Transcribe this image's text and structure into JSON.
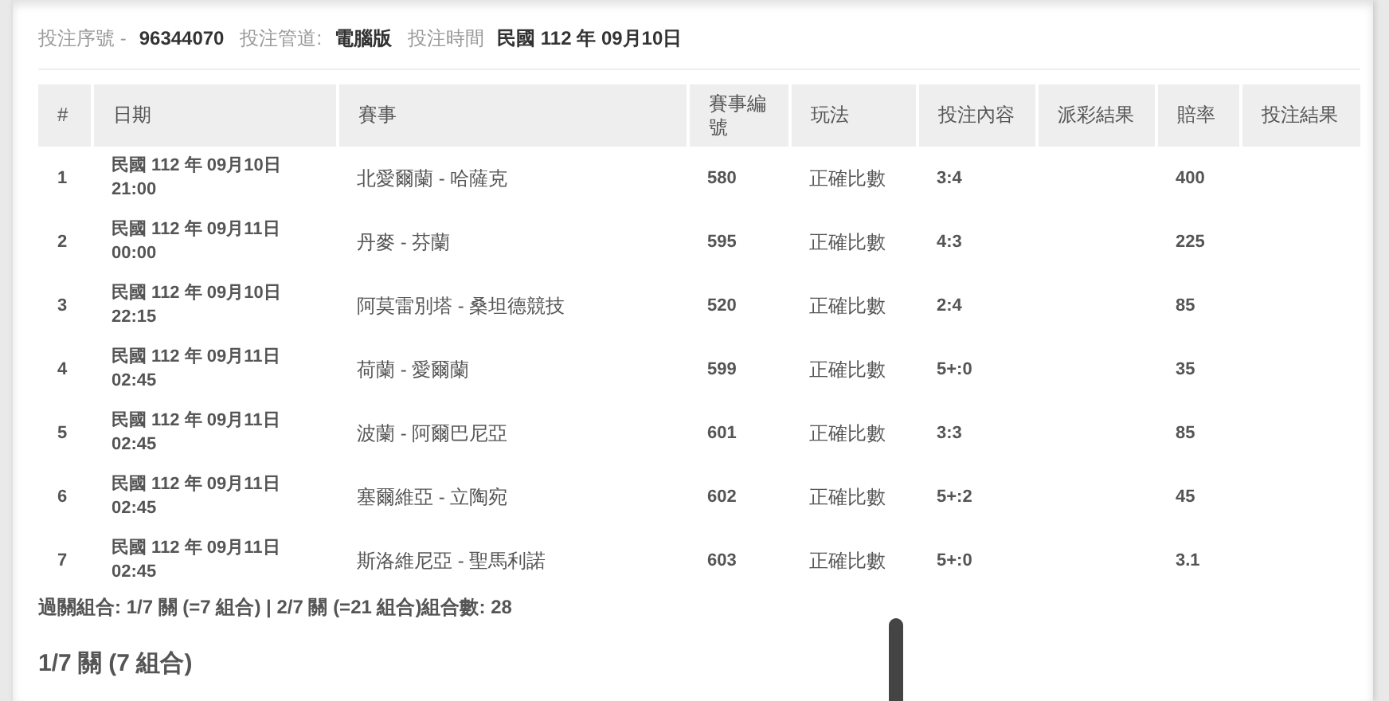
{
  "bet_info": [
    {
      "label": "投注序號 -",
      "value": "96344070"
    },
    {
      "label": "投注管道:",
      "value": "電腦版"
    },
    {
      "label": "投注時間",
      "value": "民國 112 年 09月10日"
    }
  ],
  "table": {
    "columns": [
      "#",
      "日期",
      "賽事",
      "賽事編號",
      "玩法",
      "投注內容",
      "派彩結果",
      "賠率",
      "投注結果"
    ],
    "rows": [
      {
        "no": "1",
        "date": "民國 112 年 09月10日",
        "time": "21:00",
        "match": "北愛爾蘭 - 哈薩克",
        "match_no": "580",
        "play": "正確比數",
        "bet": "3:4",
        "odds": "400"
      },
      {
        "no": "2",
        "date": "民國 112 年 09月11日",
        "time": "00:00",
        "match": "丹麥 - 芬蘭",
        "match_no": "595",
        "play": "正確比數",
        "bet": "4:3",
        "odds": "225"
      },
      {
        "no": "3",
        "date": "民國 112 年 09月10日",
        "time": "22:15",
        "match": "阿莫雷別塔 - 桑坦德競技",
        "match_no": "520",
        "play": "正確比數",
        "bet": "2:4",
        "odds": "85"
      },
      {
        "no": "4",
        "date": "民國 112 年 09月11日",
        "time": "02:45",
        "match": "荷蘭 - 愛爾蘭",
        "match_no": "599",
        "play": "正確比數",
        "bet": "5+:0",
        "odds": "35"
      },
      {
        "no": "5",
        "date": "民國 112 年 09月11日",
        "time": "02:45",
        "match": "波蘭 - 阿爾巴尼亞",
        "match_no": "601",
        "play": "正確比數",
        "bet": "3:3",
        "odds": "85"
      },
      {
        "no": "6",
        "date": "民國 112 年 09月11日",
        "time": "02:45",
        "match": "塞爾維亞 - 立陶宛",
        "match_no": "602",
        "play": "正確比數",
        "bet": "5+:2",
        "odds": "45"
      },
      {
        "no": "7",
        "date": "民國 112 年 09月11日",
        "time": "02:45",
        "match": "斯洛維尼亞 - 聖馬利諾",
        "match_no": "603",
        "play": "正確比數",
        "bet": "5+:0",
        "odds": "3.1"
      }
    ]
  },
  "summary": "過關組合: 1/7 關 (=7 組合) | 2/7 關 (=21 組合)組合數: 28",
  "section_heading": "1/7 關 (7 組合)"
}
